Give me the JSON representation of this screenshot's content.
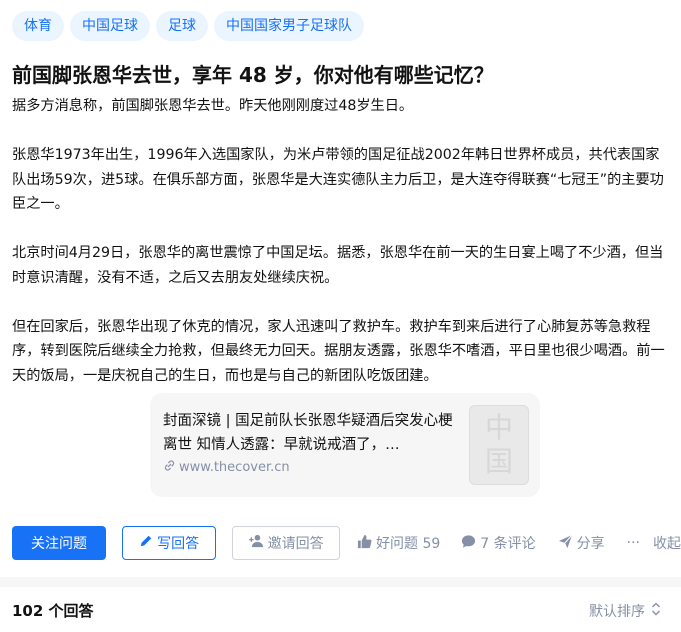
{
  "tags": [
    "体育",
    "中国足球",
    "足球",
    "中国国家男子足球队"
  ],
  "question": {
    "title": "前国脚张恩华去世，享年 48 岁，你对他有哪些记忆？",
    "paragraphs": [
      "据多方消息称，前国脚张恩华去世。昨天他刚刚度过48岁生日。",
      "张恩华1973年出生，1996年入选国家队，为米卢带领的国足征战2002年韩日世界杯成员，共代表国家队出场59次，进5球。在俱乐部方面，张恩华是大连实德队主力后卫，是大连夺得联赛“七冠王”的主要功臣之一。",
      "北京时间4月29日，张恩华的离世震惊了中国足坛。据悉，张恩华在前一天的生日宴上喝了不少酒，但当时意识清醒，没有不适，之后又去朋友处继续庆祝。",
      "但在回家后，张恩华出现了休克的情况，家人迅速叫了救护车。救护车到来后进行了心肺复苏等急救程序，转到医院后继续全力抢救，但最终无力回天。据朋友透露，张恩华不嗜酒，平日里也很少喝酒。前一天的饭局，一是庆祝自己的生日，而也是与自己的新团队吃饭团建。"
    ]
  },
  "link_card": {
    "title": "封面深镜 | 国足前队长张恩华疑酒后突发心梗离世 知情人透露：早就说戒酒了，…",
    "url": "www.thecover.cn",
    "thumb_chars": [
      "中",
      "国"
    ]
  },
  "actions": {
    "follow": "关注问题",
    "write": "写回答",
    "invite": "邀请回答",
    "good_question": "好问题 59",
    "comments": "7 条评论",
    "share": "分享",
    "more": "···",
    "collapse": "收起"
  },
  "answers": {
    "count_label": "102 个回答",
    "sort_label": "默认排序"
  },
  "colors": {
    "accent": "#1772f6",
    "tag_bg": "#ebf5ff",
    "muted": "#8590a6"
  }
}
